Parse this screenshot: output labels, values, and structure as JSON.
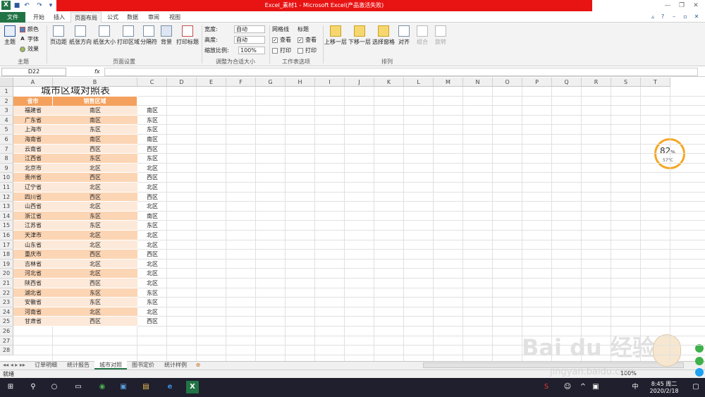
{
  "window": {
    "title": "Excel_素材1 - Microsoft Excel(产品激活失败)",
    "app_icon": "X"
  },
  "tabs": [
    "文件",
    "开始",
    "插入",
    "页面布局",
    "公式",
    "数据",
    "审阅",
    "视图"
  ],
  "ribbon": {
    "theme_group": {
      "big": "主题",
      "colors": "颜色",
      "fonts": "字体",
      "effects": "效果",
      "label": "主题"
    },
    "page_setup": {
      "buttons": [
        "页边距",
        "纸张方向",
        "纸张大小",
        "打印区域",
        "分隔符",
        "背景",
        "打印标题"
      ],
      "label": "页面设置"
    },
    "scale": {
      "width_label": "宽度:",
      "width_value": "自动",
      "height_label": "高度:",
      "height_value": "自动",
      "scale_label": "缩放比例:",
      "scale_value": "100%",
      "label": "调整为合适大小"
    },
    "sheet_options": {
      "gridlines": "网格线",
      "headings": "标题",
      "view": "查看",
      "print": "打印",
      "label": "工作表选项"
    },
    "arrange": {
      "buttons": [
        "上移一层",
        "下移一层",
        "选择窗格",
        "对齐",
        "组合",
        "旋转"
      ],
      "label": "排列"
    }
  },
  "formula_bar": {
    "name_box": "D22",
    "fx": "fx",
    "content": ""
  },
  "grid": {
    "columns": [
      "A",
      "B",
      "C",
      "D",
      "E",
      "F",
      "G",
      "H",
      "I",
      "J",
      "K",
      "L",
      "M",
      "N",
      "O",
      "P",
      "Q",
      "R",
      "S",
      "T"
    ],
    "rows": [
      "1",
      "2",
      "3",
      "4",
      "5",
      "6",
      "7",
      "8",
      "9",
      "10",
      "11",
      "12",
      "13",
      "14",
      "15",
      "16",
      "17",
      "18",
      "19",
      "20",
      "21",
      "22",
      "23",
      "24",
      "25",
      "26",
      "27",
      "28"
    ],
    "table_title": "城市区域对照表",
    "header": [
      "省市",
      "销售区域"
    ],
    "data": [
      [
        "福建省",
        "南区",
        "南区"
      ],
      [
        "广东省",
        "南区",
        "东区"
      ],
      [
        "上海市",
        "东区",
        "东区"
      ],
      [
        "海南省",
        "南区",
        "南区"
      ],
      [
        "云南省",
        "西区",
        "西区"
      ],
      [
        "江西省",
        "东区",
        "东区"
      ],
      [
        "北京市",
        "北区",
        "北区"
      ],
      [
        "贵州省",
        "西区",
        "西区"
      ],
      [
        "辽宁省",
        "北区",
        "北区"
      ],
      [
        "四川省",
        "西区",
        "西区"
      ],
      [
        "山西省",
        "北区",
        "北区"
      ],
      [
        "浙江省",
        "东区",
        "南区"
      ],
      [
        "江苏省",
        "东区",
        "东区"
      ],
      [
        "天津市",
        "北区",
        "北区"
      ],
      [
        "山东省",
        "北区",
        "北区"
      ],
      [
        "重庆市",
        "西区",
        "西区"
      ],
      [
        "吉林省",
        "北区",
        "北区"
      ],
      [
        "河北省",
        "北区",
        "北区"
      ],
      [
        "陕西省",
        "西区",
        "北区"
      ],
      [
        "湖北省",
        "东区",
        "东区"
      ],
      [
        "安徽省",
        "东区",
        "东区"
      ],
      [
        "河南省",
        "北区",
        "北区"
      ],
      [
        "甘肃省",
        "西区",
        "西区"
      ]
    ]
  },
  "sheets": [
    "订单明细",
    "统计报告",
    "城市对照",
    "图书定价",
    "统计样例"
  ],
  "status": {
    "ready": "就绪",
    "zoom": "100%"
  },
  "widget": {
    "percent": "82",
    "percent_sign": "%",
    "temp": "57°C"
  },
  "watermark": {
    "line1": "Bai du 经验",
    "line2": "jingyan.baidu.com"
  },
  "taskbar": {
    "time": "8:45 周二",
    "date": "2020/2/18",
    "ime": "中"
  },
  "colors": {
    "header_fill": "#f4a15d",
    "band_light": "#fde9d9",
    "band_dark": "#fcd5b4",
    "title_red": "#e81414",
    "file_tab": "#217346"
  }
}
